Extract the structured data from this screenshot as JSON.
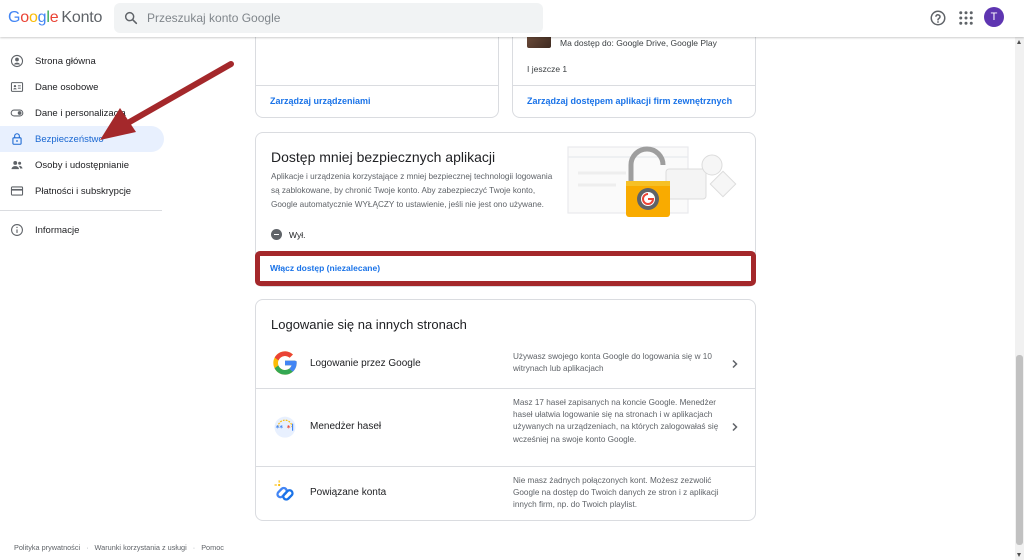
{
  "header": {
    "logo_google": [
      "G",
      "o",
      "o",
      "g",
      "l",
      "e"
    ],
    "logo_konto": "Konto",
    "search_placeholder": "Przeszukaj konto Google",
    "avatar_initial": "T",
    "icons": [
      "search-icon",
      "help-icon",
      "apps-grid-icon"
    ]
  },
  "sidebar": {
    "items": [
      {
        "label": "Strona główna",
        "icon": "account-circle-icon"
      },
      {
        "label": "Dane osobowe",
        "icon": "id-card-icon"
      },
      {
        "label": "Dane i personalizacja",
        "icon": "toggle-icon"
      },
      {
        "label": "Bezpieczeństwo",
        "icon": "lock-icon",
        "active": true
      },
      {
        "label": "Osoby i udostępnianie",
        "icon": "people-icon"
      },
      {
        "label": "Płatności i subskrypcje",
        "icon": "credit-card-icon"
      },
      {
        "label": "Informacje",
        "icon": "info-icon"
      }
    ]
  },
  "devices_card": {
    "manage_link": "Zarządzaj urządzeniami"
  },
  "apps_card": {
    "app_access": "Ma dostęp do: Google Drive, Google Play",
    "more": "I jeszcze 1",
    "manage_link": "Zarządzaj dostępem aplikacji firm zewnętrznych"
  },
  "less_secure": {
    "title": "Dostęp mniej bezpiecznych aplikacji",
    "description": "Aplikacje i urządzenia korzystające z mniej bezpiecznej technologii logowania są zablokowane, by chronić Twoje konto. Aby zabezpieczyć Twoje konto, Google automatycznie WYŁĄCZY to ustawienie, jeśli nie jest ono używane.",
    "status": "Wył.",
    "enable_link": "Włącz dostęp (niezalecane)"
  },
  "other_sites": {
    "title": "Logowanie się na innych stronach",
    "rows": [
      {
        "label": "Logowanie przez Google",
        "description": "Używasz swojego konta Google do logowania się w 10 witrynach lub aplikacjach",
        "icon": "google-g-icon"
      },
      {
        "label": "Menedżer haseł",
        "description": "Masz 17 haseł zapisanych na koncie Google. Menedżer haseł ułatwia logowanie się na stronach i w aplikacjach używanych na urządzeniach, na których zalogowałaś się wcześniej na swoje konto Google.",
        "icon": "password-manager-icon"
      },
      {
        "label": "Powiązane konta",
        "description": "Nie masz żadnych połączonych kont. Możesz zezwolić Google na dostęp do Twoich danych ze stron i z aplikacji innych firm, np. do Twoich playlist.",
        "icon": "linked-accounts-icon"
      }
    ]
  },
  "footer": {
    "links": [
      "Polityka prywatności",
      "Warunki korzystania z usługi",
      "Pomoc"
    ]
  },
  "colors": {
    "accent": "#1a73e8",
    "active_bg": "#e8f0fe",
    "annotation_red": "#a4282b",
    "avatar": "#5e35b1"
  }
}
